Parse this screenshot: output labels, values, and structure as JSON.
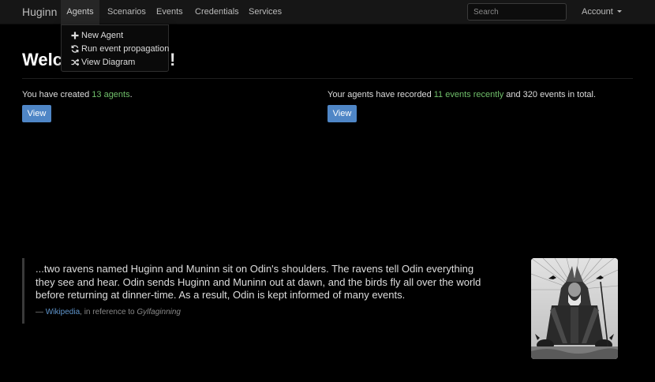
{
  "nav": {
    "brand": "Huginn",
    "items": [
      "Agents",
      "Scenarios",
      "Events",
      "Credentials",
      "Services"
    ],
    "search_placeholder": "Search",
    "account": "Account"
  },
  "agents_menu": {
    "items": [
      {
        "label": "New Agent",
        "icon": "plus-icon"
      },
      {
        "label": "Run event propagation",
        "icon": "refresh-icon"
      },
      {
        "label": "View Diagram",
        "icon": "shuffle-icon"
      }
    ]
  },
  "heading": {
    "left": "Welc",
    "right": "!"
  },
  "agents_stat": {
    "prefix": "You have created ",
    "link": "13 agents",
    "suffix": ".",
    "button": "View"
  },
  "events_stat": {
    "prefix": "Your agents have recorded ",
    "link": "11 events recently",
    "suffix": " and 320 events in total.",
    "button": "View"
  },
  "quote": {
    "text": "...two ravens named Huginn and Muninn sit on Odin's shoulders. The ravens tell Odin everything they see and hear. Odin sends Huginn and Muninn out at dawn, and the birds fly all over the world before returning at dinner-time. As a result, Odin is kept informed of many events.",
    "dash": "— ",
    "source_link": "Wikipedia",
    "source_mid": ", in reference to ",
    "source_work": "Gylfaginning"
  },
  "colors": {
    "accent_button": "#4f86c6",
    "link_green": "#6fbf6a",
    "link_blue": "#5f95cc"
  }
}
